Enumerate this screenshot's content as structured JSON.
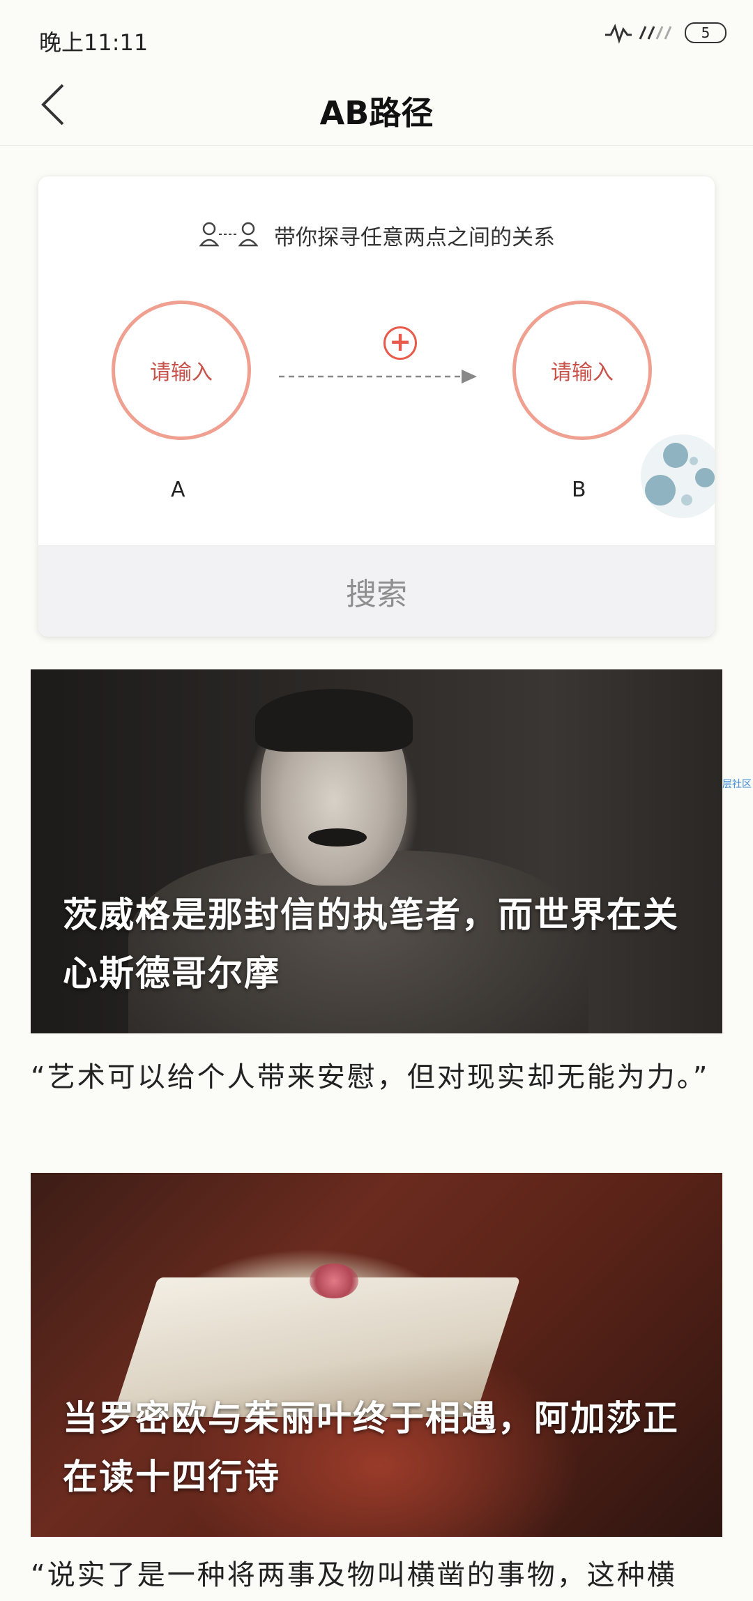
{
  "status_bar": {
    "time": "晚上11:11",
    "battery": "5"
  },
  "header": {
    "title": "AB路径"
  },
  "ab_card": {
    "subtitle": "带你探寻任意两点之间的关系",
    "node_a_placeholder": "请输入",
    "node_b_placeholder": "请输入",
    "label_a": "A",
    "label_b": "B",
    "add_symbol": "+",
    "search_label": "搜索"
  },
  "side_tag": "深层社区",
  "articles": [
    {
      "title": "茨威格是那封信的执笔者，而世界在关心斯德哥尔摩",
      "quote": "“艺术可以给个人带来安慰，但对现实却无能为力。”"
    },
    {
      "title": "当罗密欧与茱丽叶终于相遇，阿加莎正在读十四行诗",
      "quote": "“说实了是一种将两事及物叫横凿的事物，这种横"
    }
  ],
  "colors": {
    "accent": "#e85a4a",
    "circle_border": "#f0a090",
    "background": "#fbfbf7"
  },
  "icons": [
    "back-chevron-icon",
    "signal-icon",
    "battery-icon",
    "relation-icon",
    "plus-icon",
    "arrow-icon",
    "planet-decoration"
  ]
}
